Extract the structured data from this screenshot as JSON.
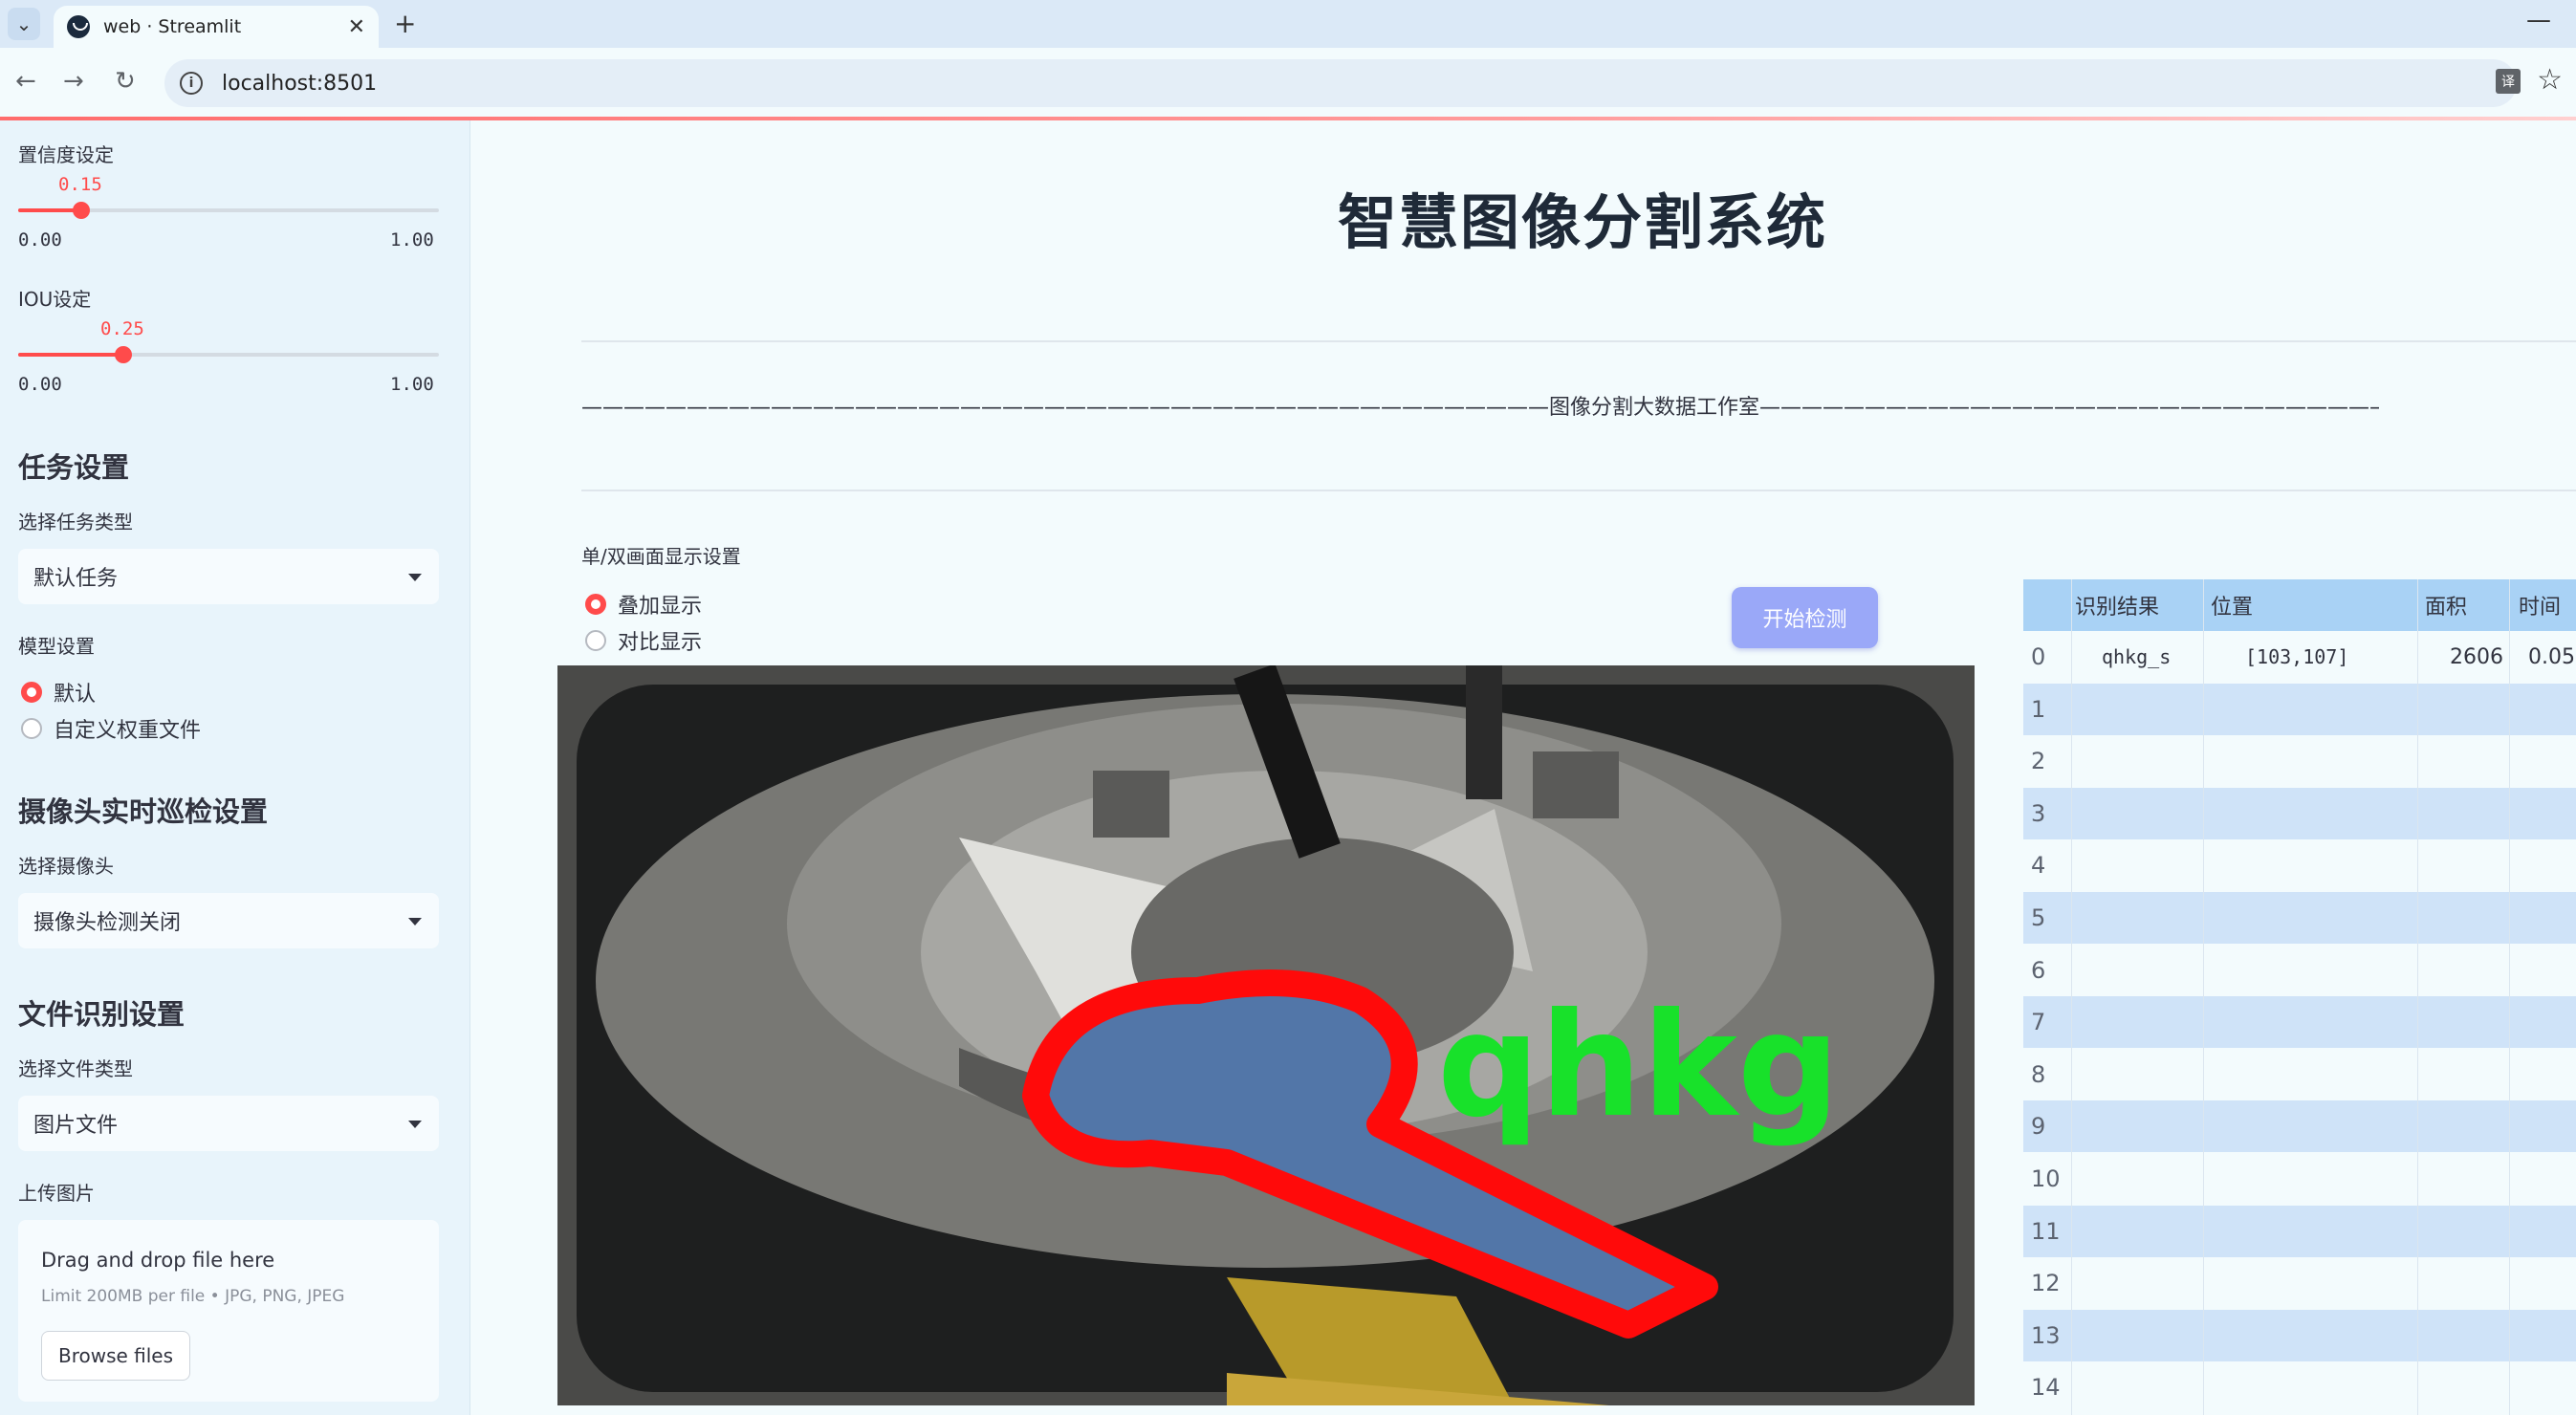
{
  "browser": {
    "tab_title": "web · Streamlit",
    "url": "localhost:8501"
  },
  "sidebar": {
    "confidence": {
      "label": "置信度设定",
      "value": "0.15",
      "min": "0.00",
      "max": "1.00",
      "fraction": 0.15
    },
    "iou": {
      "label": "IOU设定",
      "value": "0.25",
      "min": "0.00",
      "max": "1.00",
      "fraction": 0.25
    },
    "task_heading": "任务设置",
    "task_type_label": "选择任务类型",
    "task_type_value": "默认任务",
    "model_label": "模型设置",
    "model_options": [
      "默认",
      "自定义权重文件"
    ],
    "camera_heading": "摄像头实时巡检设置",
    "camera_label": "选择摄像头",
    "camera_value": "摄像头检测关闭",
    "file_heading": "文件识别设置",
    "file_type_label": "选择文件类型",
    "file_type_value": "图片文件",
    "upload_label": "上传图片",
    "upload_title": "Drag and drop file here",
    "upload_sub": "Limit 200MB per file • JPG, PNG, JPEG",
    "browse_label": "Browse files"
  },
  "main": {
    "title": "智慧图像分割系统",
    "studio_line": "——————————————————————————————————————————————图像分割大数据工作室——————————————————————————————————————————————",
    "display_label": "单/双画面显示设置",
    "display_options": [
      "叠加显示",
      "对比显示"
    ],
    "detect_button": "开始检测",
    "overlay_text": "qhkg"
  },
  "table": {
    "columns": [
      "识别结果",
      "位置",
      "面积",
      "时间"
    ],
    "rows": [
      {
        "index": "0",
        "result": "qhkg_s",
        "position": "[103,107]",
        "area": "2606",
        "time": "0.05"
      },
      {
        "index": "1"
      },
      {
        "index": "2"
      },
      {
        "index": "3"
      },
      {
        "index": "4"
      },
      {
        "index": "5"
      },
      {
        "index": "6"
      },
      {
        "index": "7"
      },
      {
        "index": "8"
      },
      {
        "index": "9"
      },
      {
        "index": "10"
      },
      {
        "index": "11"
      },
      {
        "index": "12"
      },
      {
        "index": "13"
      },
      {
        "index": "14"
      }
    ]
  },
  "colors": {
    "accent": "#ff4b4b",
    "button": "#9aa8f8",
    "table_header": "#a9d2f5",
    "table_alt": "#cfe3f8"
  }
}
